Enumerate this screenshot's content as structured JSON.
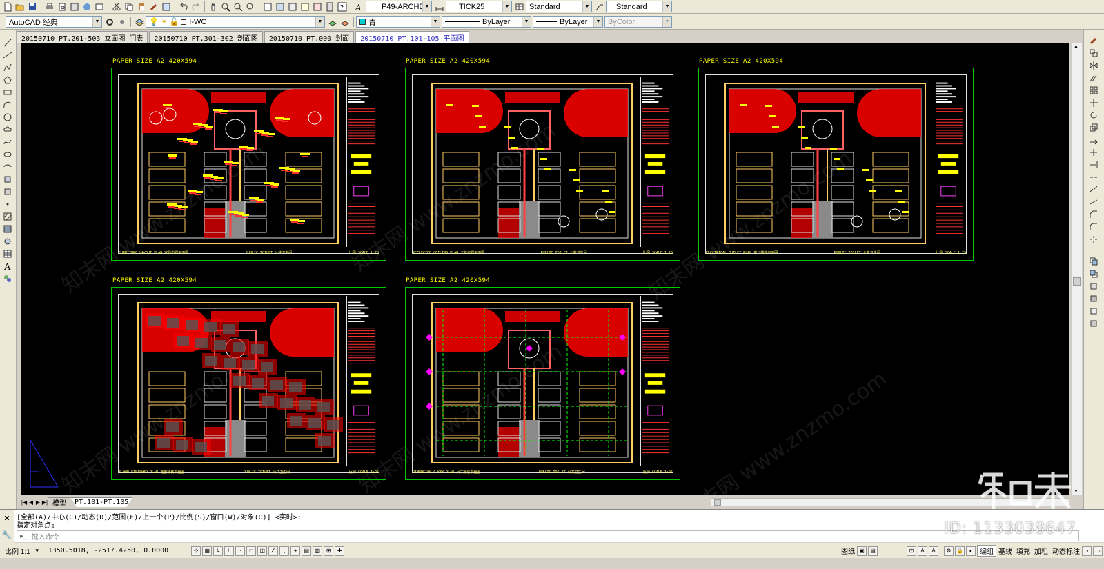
{
  "toolbar1": {
    "textstyle": "P49-ARCHD",
    "dimstyle": "TICK25",
    "tablestyle": "Standard",
    "mlstyle": "Standard"
  },
  "toolbar2": {
    "workspace": "AutoCAD 经典",
    "layer": "I-WC",
    "color": "青",
    "linetype": "ByLayer",
    "lineweight": "ByLayer",
    "plotstyle": "ByColor"
  },
  "file_tabs": [
    {
      "label": "20150710 PT.201-503 立面图 门表"
    },
    {
      "label": "20150710 PT.301-302 剖面图"
    },
    {
      "label": "20150710 PT.000 封面"
    },
    {
      "label": "20150710 PT.101-105 平面图"
    }
  ],
  "sheets": [
    {
      "title": "PAPER SIZE A2  420X594",
      "foot_left": "FURNITURE LAYOUT PLAN  家具布置平面图",
      "foot_mid": "PUBLIC TOILET 公共卫生间",
      "foot_right": "比例 SCALE  1:25"
    },
    {
      "title": "PAPER SIZE A2  420X594",
      "foot_left": "REFLECTED CEILING PLAN  天花布置平面图",
      "foot_mid": "PUBLIC TOILET 公共卫生间",
      "foot_right": "比例 SCALE  1:25"
    },
    {
      "title": "PAPER SIZE A2  420X594",
      "foot_left": "ELECTRICAL OUTLET PLAN  电气插座平面图",
      "foot_mid": "PUBLIC TOILET 公共卫生间",
      "foot_right": "比例 SCALE  1:25"
    },
    {
      "title": "PAPER SIZE A2  420X594",
      "foot_left": "FLOOR FINISHED PLAN  地面铺装平面图",
      "foot_mid": "PUBLIC TOILET 公共卫生间",
      "foot_right": "比例 SCALE  1:25"
    },
    {
      "title": "PAPER SIZE A2  420X594",
      "foot_left": "DIMENSION & KEY PLAN  尺寸定位平面图",
      "foot_mid": "PUBLIC TOILET 公共卫生间",
      "foot_right": "比例 SCALE  1:25"
    }
  ],
  "layout_tabs": {
    "model": "模型",
    "layout": "PT.101-PT.105"
  },
  "command": {
    "line1": "[全部(A)/中心(C)/动态(D)/范围(E)/上一个(P)/比例(S)/窗口(W)/对象(O)] <实时>:",
    "line2": "指定对角点:",
    "placeholder": "键入命令"
  },
  "status": {
    "scale": "比例 1:1",
    "coords": "1350.5018, -2517.4250, 0.0000",
    "paper": "图纸",
    "edit": "编组",
    "baseline": "基线",
    "fill": "填充",
    "thicken": "加粗",
    "dynamic": "动态标注"
  },
  "watermark": {
    "text": "知末网 www.znzmo.com",
    "brand": "知末",
    "id": "ID: 1133038647"
  },
  "colors": {
    "canvas": "#000000",
    "frame": "#00c800",
    "title": "#ffff00",
    "hatch": "#ff0000"
  }
}
